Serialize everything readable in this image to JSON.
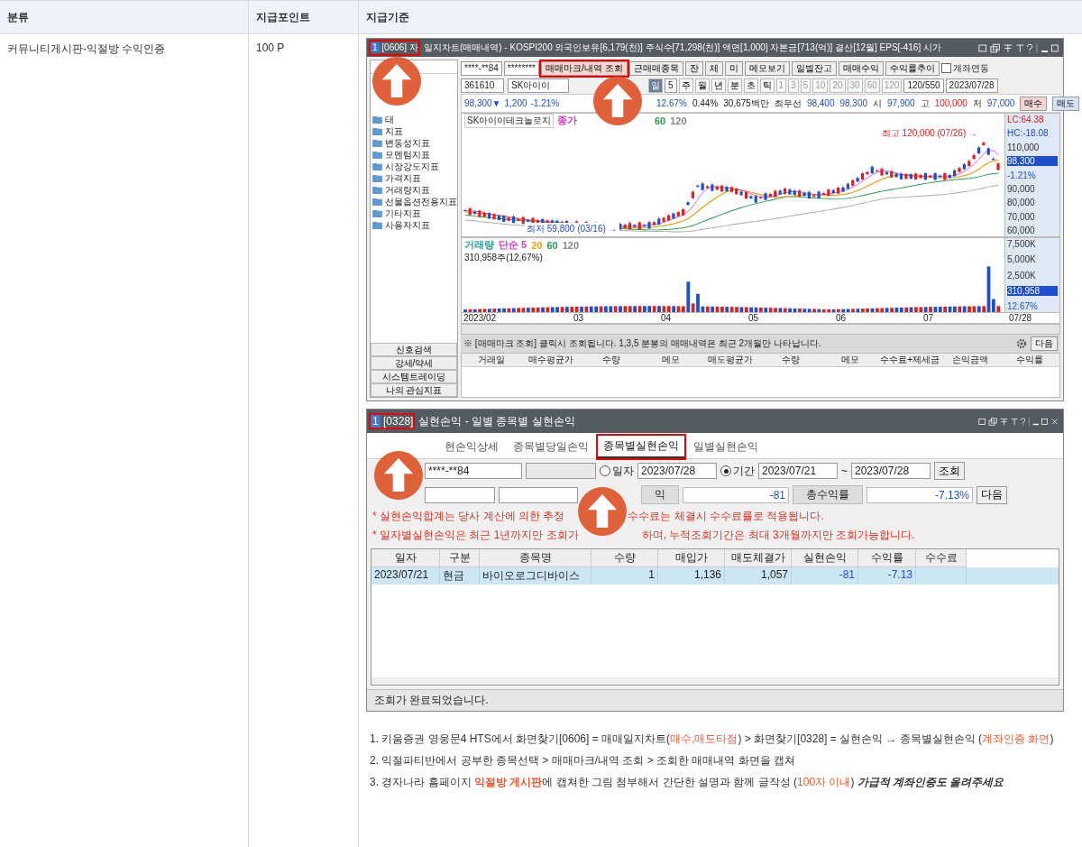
{
  "table": {
    "columns": [
      "분류",
      "지급포인트",
      "지급기준"
    ],
    "row": {
      "category": "커뮤니티게시판-익절방 수익인증",
      "points": "100 P"
    }
  },
  "chart_window": {
    "badge": "1",
    "code": "[0606] 자",
    "code_highlighted": true,
    "title": "일지차트(매매내역) - KOSPI200 외국인보유[6,179(천)] 주식수[71,298(천)] 액면[1,000] 자본금[713(억)] 결산[12월] EPS[-416] 시가",
    "tree": [
      "태",
      "지표",
      "변동성지표",
      "모멘텀지표",
      "시장강도지표",
      "가격지표",
      "거래량지표",
      "선물옵션전용지표",
      "기타지표",
      "사용자지표"
    ],
    "side_buttons": [
      "신호검색",
      "강세/약세",
      "시스템트레이딩",
      "나의 관심지표"
    ],
    "account": "****-**84",
    "password": "********",
    "buttons": [
      {
        "label": "매매마크/내역 조회",
        "highlighted": true
      },
      {
        "label": "근매매종목",
        "highlighted": false
      },
      {
        "label": "잔",
        "highlighted": false
      },
      {
        "label": "체",
        "highlighted": false
      },
      {
        "label": "미",
        "highlighted": false
      },
      {
        "label": "메모보기",
        "highlighted": false
      },
      {
        "label": "일별잔고",
        "highlighted": false
      },
      {
        "label": "매매수익",
        "highlighted": false
      },
      {
        "label": "수익률추이",
        "highlighted": false
      }
    ],
    "link_checkbox": {
      "label": "계좌연동",
      "checked": false
    },
    "stock_code": "361610",
    "stock_name": "SK아이이",
    "period_count": "5",
    "periods": [
      {
        "label": "일",
        "selected": true
      },
      {
        "label": "주",
        "selected": false
      },
      {
        "label": "월",
        "selected": false
      },
      {
        "label": "년",
        "selected": false
      },
      {
        "label": "분",
        "selected": false
      },
      {
        "label": "초",
        "selected": false
      },
      {
        "label": "틱",
        "selected": false
      }
    ],
    "minutes": [
      "1",
      "3",
      "5",
      "10",
      "20",
      "30",
      "60",
      "120"
    ],
    "range": "120/550",
    "date": "2023/07/28",
    "quote": [
      {
        "text": "98,300▼",
        "kind": "down"
      },
      {
        "text": "1,200",
        "kind": "down"
      },
      {
        "text": "-1.21%",
        "kind": "down"
      },
      {
        "text": "12.67%",
        "kind": "down"
      },
      {
        "text": "0.44%",
        "kind": "plain"
      },
      {
        "text": "30,675백만",
        "kind": "plain"
      },
      {
        "text": "최우선",
        "kind": "plain"
      },
      {
        "text": "98,400",
        "kind": "down"
      },
      {
        "text": "98,300",
        "kind": "down"
      },
      {
        "text": "시",
        "kind": "plain"
      },
      {
        "text": "97,900",
        "kind": "down"
      },
      {
        "text": "고",
        "kind": "plain"
      },
      {
        "text": "100,000",
        "kind": "up"
      },
      {
        "text": "저",
        "kind": "plain"
      },
      {
        "text": "97,000",
        "kind": "down"
      }
    ],
    "trade_buttons": [
      {
        "label": "매수",
        "kind": "buy"
      },
      {
        "label": "매도",
        "kind": "sell"
      }
    ],
    "price_legend_name": "SK아이이테크놀로지",
    "price_legend": [
      {
        "text": "종가",
        "color": "#d63ad6"
      },
      {
        "text": "60",
        "color": "#22a050"
      },
      {
        "text": "120",
        "color": "#888888"
      }
    ],
    "high_note": "최고 120,000 (07/26) →",
    "low_note": "최저 59,800 (03/16) →",
    "price_axis": [
      {
        "text": "LC:64.38",
        "kind": "up"
      },
      {
        "text": "HC:-18.08",
        "kind": "down"
      },
      {
        "text": "110,000",
        "kind": "tick"
      },
      {
        "text": "98,300",
        "kind": "tag"
      },
      {
        "text": "-1.21%",
        "kind": "down"
      },
      {
        "text": "90,000",
        "kind": "tick"
      },
      {
        "text": "80,000",
        "kind": "tick"
      },
      {
        "text": "70,000",
        "kind": "tick"
      },
      {
        "text": "60,000",
        "kind": "tick"
      }
    ],
    "volume_legend": [
      {
        "text": "거래량",
        "color": "#2aa198"
      },
      {
        "text": "단순 5",
        "color": "#d63ad6"
      },
      {
        "text": "20",
        "color": "#e8a317"
      },
      {
        "text": "60",
        "color": "#22a050"
      },
      {
        "text": "120",
        "color": "#888888"
      }
    ],
    "volume_reading": "310,958주(12,67%)",
    "volume_axis": [
      {
        "text": "7,500K",
        "kind": "tick"
      },
      {
        "text": "5,000K",
        "kind": "tick"
      },
      {
        "text": "2,500K",
        "kind": "tick"
      },
      {
        "text": "310,958",
        "kind": "tag"
      },
      {
        "text": "12.67%",
        "kind": "down"
      }
    ],
    "x_labels": [
      "2023/02",
      "03",
      "04",
      "05",
      "06",
      "07"
    ],
    "x_end": "07/28",
    "note": "※ [매매마크 조회] 클릭시 조회됩니다. 1,3,5 분봉의 매매내역은 최근 2개월만 나타납니다.",
    "next_button": "다음",
    "trade_columns": [
      "거래일",
      "매수평균가",
      "수량",
      "메모",
      "매도평균가",
      "수량",
      "메모",
      "수수료+제세금",
      "손익금액",
      "수익률"
    ]
  },
  "pnl_window": {
    "badge": "1",
    "code": "[0328]",
    "code_highlighted": true,
    "title": "실현손익 - 일별 종목별 실현손익",
    "tabs": [
      {
        "label": "현손익상세",
        "selected": false
      },
      {
        "label": "종목별당일손익",
        "selected": false
      },
      {
        "label": "종목별실현손익",
        "selected": true
      },
      {
        "label": "일별실현손익",
        "selected": false
      }
    ],
    "account": "****-**84",
    "date_modes": [
      {
        "label": "일자",
        "selected": false,
        "dates": [
          "2023/07/28"
        ]
      },
      {
        "label": "기간",
        "selected": true,
        "dates": [
          "2023/07/21",
          "2023/07/28"
        ]
      }
    ],
    "date_separator": "~",
    "search_button": "조회",
    "summary": [
      {
        "label": "익",
        "value": "-81"
      },
      {
        "label": "총수익률",
        "value": "-7.13%"
      }
    ],
    "next_button": "다음",
    "notes": [
      {
        "parts": [
          "* 실현손익합계는 당사 계산에 의한 추정",
          "수수료는 체결시 수수료률로 적용됩니다."
        ]
      },
      {
        "parts": [
          "* 일자별실현손익은 최근 1년까지만 조회가",
          "하며, 누적조회기간은 최대 3개월까지만 조회가능합니다."
        ]
      }
    ],
    "columns": [
      "일자",
      "구분",
      "종목명",
      "수량",
      "매입가",
      "매도체결가",
      "실현손익",
      "수익률",
      "수수료"
    ],
    "rows": [
      {
        "selected": true,
        "cells": [
          "2023/07/21",
          "현금",
          "바이오로그디바이스",
          "1",
          "1,136",
          "1,057",
          "-81",
          "-7.13",
          ""
        ]
      }
    ],
    "status": "조회가 완료되었습니다."
  },
  "instructions": [
    {
      "parts": [
        {
          "text": "1. 키움증권 영웅문4 HTS에서 화면찾기[0606] = 매매일지차트(",
          "kind": "plain"
        },
        {
          "text": "매수,매도타점",
          "kind": "accent"
        },
        {
          "text": ")  >  화면찾기[0328] = 실현손익 → 종목별실현손익 (",
          "kind": "plain"
        },
        {
          "text": "계좌인증 화면",
          "kind": "accent"
        },
        {
          "text": ")",
          "kind": "plain"
        }
      ]
    },
    {
      "parts": [
        {
          "text": "2. 익절파티반에서 공부한 종목선택 > 매매마크/내역 조회 > 조회한 매매내역 화면을 캡쳐",
          "kind": "plain"
        }
      ]
    },
    {
      "parts": [
        {
          "text": "3. 경자나라 홈페이지 ",
          "kind": "plain"
        },
        {
          "text": "익절방 게시판",
          "kind": "accent_bold"
        },
        {
          "text": "에 캡쳐한 그림 첨부해서 간단한 설명과 함께 글작성 (",
          "kind": "plain"
        },
        {
          "text": "100자 이내",
          "kind": "accent"
        },
        {
          "text": ") ",
          "kind": "plain"
        },
        {
          "text": "가급적 계좌인증도 올려주세요",
          "kind": "bold_italic"
        }
      ]
    }
  ]
}
